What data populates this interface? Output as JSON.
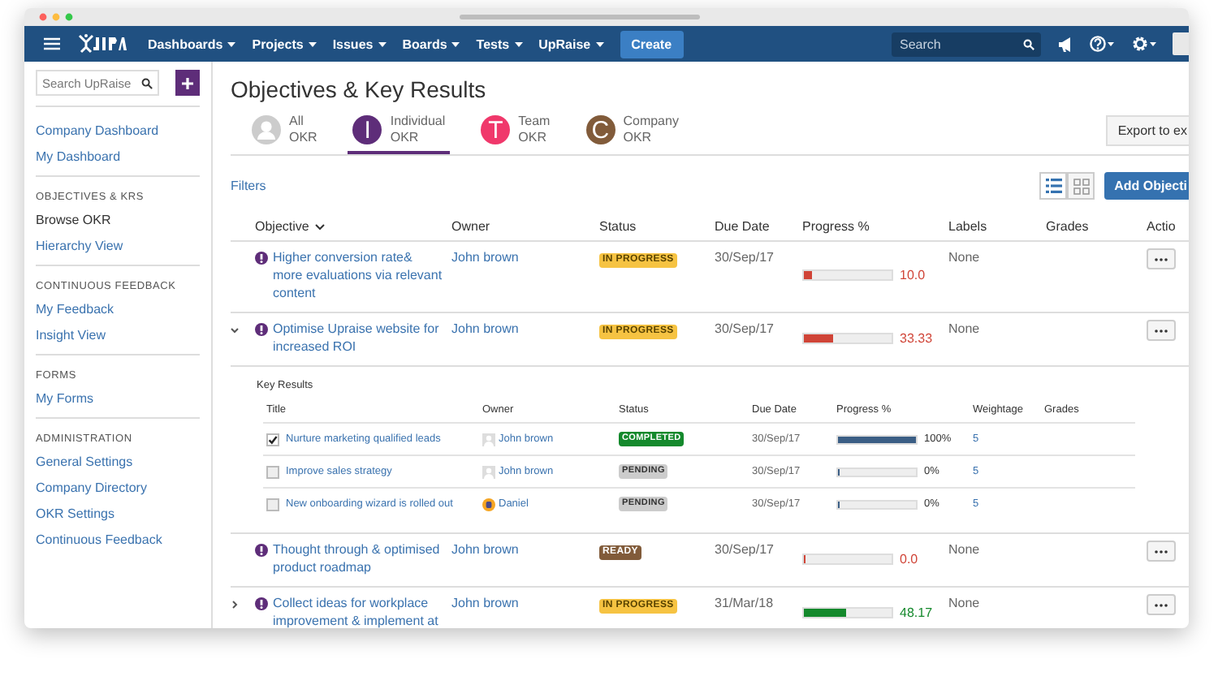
{
  "nav": {
    "menus": [
      "Dashboards",
      "Projects",
      "Issues",
      "Boards",
      "Tests",
      "UpRaise"
    ],
    "create": "Create",
    "search": {
      "placeholder": "Search"
    }
  },
  "sidebar": {
    "search": {
      "placeholder": "Search UpRaise"
    },
    "sections": [
      {
        "items": [
          {
            "label": "Company Dashboard",
            "selected": false
          },
          {
            "label": "My Dashboard",
            "selected": false
          }
        ]
      },
      {
        "heading": "OBJECTIVES & KRS",
        "items": [
          {
            "label": "Browse OKR",
            "selected": true
          },
          {
            "label": "Hierarchy View",
            "selected": false
          }
        ]
      },
      {
        "heading": "CONTINUOUS FEEDBACK",
        "items": [
          {
            "label": "My Feedback",
            "selected": false
          },
          {
            "label": "Insight View",
            "selected": false
          }
        ]
      },
      {
        "heading": "FORMS",
        "items": [
          {
            "label": "My Forms",
            "selected": false
          }
        ]
      },
      {
        "heading": "ADMINISTRATION",
        "items": [
          {
            "label": "General Settings",
            "selected": false
          },
          {
            "label": "Company Directory",
            "selected": false
          },
          {
            "label": "OKR Settings",
            "selected": false
          },
          {
            "label": "Continuous Feedback",
            "selected": false
          }
        ]
      }
    ]
  },
  "page": {
    "title": "Objectives & Key Results",
    "tabs": [
      {
        "kind": "silhouette",
        "label_lines": [
          "All",
          "OKR"
        ],
        "selected": false
      },
      {
        "kind": "letter",
        "letter": "I",
        "color": "#5e2d79",
        "label_lines": [
          "Individual",
          "OKR"
        ],
        "selected": true
      },
      {
        "kind": "letter",
        "letter": "T",
        "color": "#f0386b",
        "label_lines": [
          "Team",
          "OKR"
        ],
        "selected": false
      },
      {
        "kind": "letter",
        "letter": "C",
        "color": "#815b3a",
        "label_lines": [
          "Company",
          "OKR"
        ],
        "selected": false
      }
    ],
    "export_button": "Export to ex",
    "filters": "Filters",
    "views": [
      {
        "kind": "list",
        "selected": true
      },
      {
        "kind": "grid",
        "selected": false
      }
    ],
    "add_button": "Add Objecti"
  },
  "table": {
    "columns": [
      "Objective",
      "Owner",
      "Status",
      "Due Date",
      "Progress %",
      "Labels",
      "Grades",
      "Actio"
    ],
    "rows": [
      {
        "objective": "Higher conversion rate& more evaluations via relevant content",
        "owner": "John brown",
        "status": {
          "label": "IN PROGRESS",
          "kind": "in_progress"
        },
        "due": "30/Sep/17",
        "level": 0.1,
        "reading": "10.0",
        "color": "#d04437",
        "labels": "None",
        "expandable": false,
        "expanded": false
      },
      {
        "objective": "Optimise Upraise website for increased ROI",
        "owner": "John brown",
        "status": {
          "label": "IN PROGRESS",
          "kind": "in_progress"
        },
        "due": "30/Sep/17",
        "level": 0.3333,
        "reading": "33.33",
        "color": "#d04437",
        "labels": "None",
        "expandable": true,
        "expanded": true,
        "key_results": {
          "heading": "Key Results",
          "columns": [
            "Title",
            "Owner",
            "Status",
            "Due Date",
            "Progress %",
            "Weightage",
            "Grades"
          ],
          "rows": [
            {
              "checked": true,
              "title": "Nurture marketing qualified leads",
              "owner": {
                "name": "John brown",
                "kind": "generic"
              },
              "status": {
                "label": "COMPLETED",
                "kind": "completed"
              },
              "due": "30/Sep/17",
              "level": 1,
              "reading": "100%",
              "weightage": "5"
            },
            {
              "checked": false,
              "title": "Improve sales strategy",
              "owner": {
                "name": "John brown",
                "kind": "generic"
              },
              "status": {
                "label": "PENDING",
                "kind": "pending"
              },
              "due": "30/Sep/17",
              "level": 0,
              "reading": "0%",
              "weightage": "5"
            },
            {
              "checked": false,
              "title": "New onboarding wizard is rolled out",
              "owner": {
                "name": "Daniel",
                "kind": "badge"
              },
              "status": {
                "label": "PENDING",
                "kind": "pending"
              },
              "due": "30/Sep/17",
              "level": 0,
              "reading": "0%",
              "weightage": "5"
            }
          ]
        }
      },
      {
        "objective": "Thought through & optimised product roadmap",
        "owner": "John brown",
        "status": {
          "label": "READY",
          "kind": "ready"
        },
        "due": "30/Sep/17",
        "level": 0,
        "reading": "0.0",
        "color": "#d04437",
        "labels": "None",
        "expandable": false,
        "expanded": false
      },
      {
        "objective": "Collect ideas for workplace improvement & implement at",
        "owner": "John brown",
        "status": {
          "label": "IN PROGRESS",
          "kind": "in_progress"
        },
        "due": "31/Mar/18",
        "level": 0.4817,
        "reading": "48.17",
        "color": "#14892c",
        "labels": "None",
        "expandable": true,
        "expanded": false
      }
    ]
  }
}
